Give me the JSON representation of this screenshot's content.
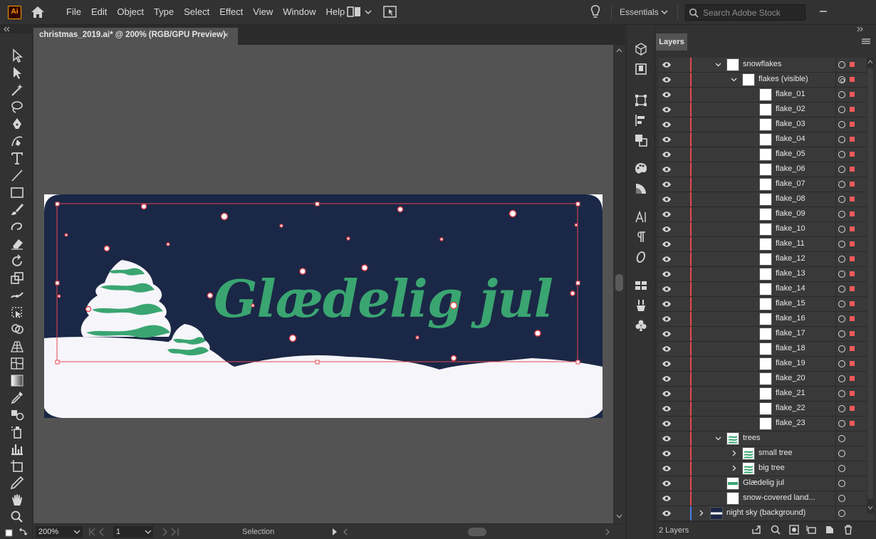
{
  "app": {
    "logo_text": "Ai"
  },
  "menu": [
    "File",
    "Edit",
    "Object",
    "Type",
    "Select",
    "Effect",
    "View",
    "Window",
    "Help"
  ],
  "workspace": "Essentials",
  "search": {
    "placeholder": "Search Adobe Stock"
  },
  "document": {
    "tab_title": "christmas_2019.ai* @ 200% (RGB/GPU Preview)",
    "close_glyph": "×",
    "artboard_text": "Glædelig jul",
    "colors": {
      "sky": "#1b2746",
      "snow": "#f6f5fa",
      "green": "#3aa571",
      "selection": "#e6474f"
    }
  },
  "status": {
    "zoom": "200%",
    "page": "1",
    "tool_label": "Selection"
  },
  "panel": {
    "tab": "Layers",
    "footer_count": "2 Layers",
    "rows": [
      {
        "name": "snowflakes",
        "indent": 1,
        "expander": "down",
        "thumb": "white",
        "target": "single",
        "sel": true,
        "bar": "#e5484d"
      },
      {
        "name": "flakes (visible)",
        "indent": 2,
        "expander": "down",
        "thumb": "white",
        "target": "double",
        "sel": true,
        "bar": "#e5484d"
      },
      {
        "name": "flake_01",
        "indent": 3,
        "thumb": "white",
        "target": "single",
        "sel": true,
        "bar": "#e5484d"
      },
      {
        "name": "flake_02",
        "indent": 3,
        "thumb": "white",
        "target": "single",
        "sel": true,
        "bar": "#e5484d"
      },
      {
        "name": "flake_03",
        "indent": 3,
        "thumb": "white",
        "target": "single",
        "sel": true,
        "bar": "#e5484d"
      },
      {
        "name": "flake_04",
        "indent": 3,
        "thumb": "white",
        "target": "single",
        "sel": true,
        "bar": "#e5484d"
      },
      {
        "name": "flake_05",
        "indent": 3,
        "thumb": "white",
        "target": "single",
        "sel": true,
        "bar": "#e5484d"
      },
      {
        "name": "flake_06",
        "indent": 3,
        "thumb": "white",
        "target": "single",
        "sel": true,
        "bar": "#e5484d"
      },
      {
        "name": "flake_07",
        "indent": 3,
        "thumb": "white",
        "target": "single",
        "sel": true,
        "bar": "#e5484d"
      },
      {
        "name": "flake_08",
        "indent": 3,
        "thumb": "white",
        "target": "single",
        "sel": true,
        "bar": "#e5484d"
      },
      {
        "name": "flake_09",
        "indent": 3,
        "thumb": "white",
        "target": "single",
        "sel": true,
        "bar": "#e5484d"
      },
      {
        "name": "flake_10",
        "indent": 3,
        "thumb": "white",
        "target": "single",
        "sel": true,
        "bar": "#e5484d"
      },
      {
        "name": "flake_11",
        "indent": 3,
        "thumb": "white",
        "target": "single",
        "sel": true,
        "bar": "#e5484d"
      },
      {
        "name": "flake_12",
        "indent": 3,
        "thumb": "white",
        "target": "single",
        "sel": true,
        "bar": "#e5484d"
      },
      {
        "name": "flake_13",
        "indent": 3,
        "thumb": "white",
        "target": "single",
        "sel": true,
        "bar": "#e5484d"
      },
      {
        "name": "flake_14",
        "indent": 3,
        "thumb": "white",
        "target": "single",
        "sel": true,
        "bar": "#e5484d"
      },
      {
        "name": "flake_15",
        "indent": 3,
        "thumb": "white",
        "target": "single",
        "sel": true,
        "bar": "#e5484d"
      },
      {
        "name": "flake_16",
        "indent": 3,
        "thumb": "white",
        "target": "single",
        "sel": true,
        "bar": "#e5484d"
      },
      {
        "name": "flake_17",
        "indent": 3,
        "thumb": "white",
        "target": "single",
        "sel": true,
        "bar": "#e5484d"
      },
      {
        "name": "flake_18",
        "indent": 3,
        "thumb": "white",
        "target": "single",
        "sel": true,
        "bar": "#e5484d"
      },
      {
        "name": "flake_19",
        "indent": 3,
        "thumb": "white",
        "target": "single",
        "sel": true,
        "bar": "#e5484d"
      },
      {
        "name": "flake_20",
        "indent": 3,
        "thumb": "white",
        "target": "single",
        "sel": true,
        "bar": "#e5484d"
      },
      {
        "name": "flake_21",
        "indent": 3,
        "thumb": "white",
        "target": "single",
        "sel": true,
        "bar": "#e5484d"
      },
      {
        "name": "flake_22",
        "indent": 3,
        "thumb": "white",
        "target": "single",
        "sel": true,
        "bar": "#e5484d"
      },
      {
        "name": "flake_23",
        "indent": 3,
        "thumb": "white",
        "target": "single",
        "sel": true,
        "bar": "#e5484d"
      },
      {
        "name": "trees",
        "indent": 1,
        "expander": "down",
        "thumb": "trees",
        "target": "single",
        "sel": false,
        "bar": "#e5484d"
      },
      {
        "name": "small tree",
        "indent": 2,
        "expander": "right",
        "thumb": "tree",
        "target": "single",
        "sel": false,
        "bar": "#e5484d"
      },
      {
        "name": "big tree",
        "indent": 2,
        "expander": "right",
        "thumb": "tree",
        "target": "single",
        "sel": false,
        "bar": "#e5484d"
      },
      {
        "name": "Glædelig jul",
        "indent": 1,
        "thumb": "text",
        "target": "single",
        "sel": false,
        "bar": "#e5484d"
      },
      {
        "name": "snow-covered land...",
        "indent": 1,
        "thumb": "white",
        "target": "single",
        "sel": false,
        "bar": "#e5484d"
      },
      {
        "name": "night sky (background)",
        "indent": 0,
        "expander": "right",
        "thumb": "sky",
        "target": "single",
        "sel": false,
        "bar": "#4a7de8"
      }
    ]
  }
}
